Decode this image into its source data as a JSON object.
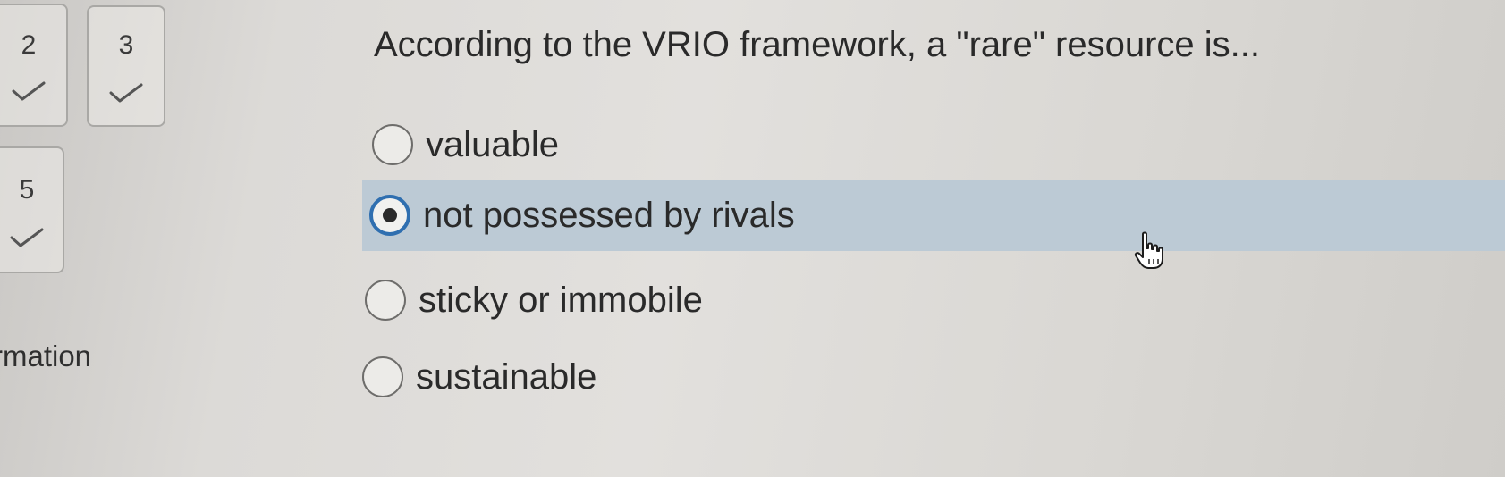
{
  "nav": {
    "tiles": [
      {
        "number": "2",
        "status": "answered"
      },
      {
        "number": "3",
        "status": "answered"
      },
      {
        "number": "5",
        "status": "answered"
      }
    ],
    "section_label_fragment": "rmation"
  },
  "question": {
    "text": "According to the VRIO framework, a \"rare\" resource is...",
    "options": [
      {
        "label": "valuable",
        "selected": false
      },
      {
        "label": "not possessed by rivals",
        "selected": true
      },
      {
        "label": "sticky or immobile",
        "selected": false
      },
      {
        "label": "sustainable",
        "selected": false
      }
    ]
  },
  "colors": {
    "selected_row": "#bccad5",
    "radio_selected_ring": "#2f6fb0",
    "text": "#2a2a2a"
  },
  "icons": {
    "answered": "checkmark-icon",
    "cursor": "hand-pointer-icon"
  }
}
